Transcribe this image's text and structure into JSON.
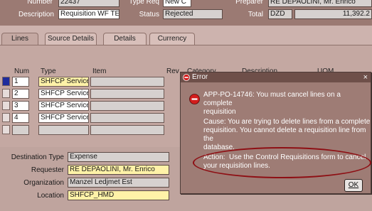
{
  "header": {
    "number_label": "Number",
    "number_value": "22437",
    "type_label": "Type Req",
    "type_value": "New C",
    "preparer_label": "Preparer",
    "preparer_value": "RE DEPAOLINI, Mr. Enrico",
    "description_label": "Description",
    "description_value": "Requisition WF TE",
    "status_label": "Status",
    "status_value": "Rejected",
    "total_label": "Total",
    "currency_value": "DZD",
    "total_value": "11,392.2"
  },
  "tabs": [
    {
      "label": "Lines"
    },
    {
      "label": "Source Details"
    },
    {
      "label": "Details"
    },
    {
      "label": "Currency"
    }
  ],
  "lines_table": {
    "columns": [
      "Num",
      "Type",
      "Item",
      "Rev",
      "Category",
      "Description",
      "UOM"
    ],
    "rows": [
      {
        "num": "1",
        "type": "SHFCP Service"
      },
      {
        "num": "2",
        "type": "SHFCP Service"
      },
      {
        "num": "3",
        "type": "SHFCP Service"
      },
      {
        "num": "4",
        "type": "SHFCP Service"
      }
    ]
  },
  "details": {
    "destination_type_label": "Destination Type",
    "destination_type_value": "Expense",
    "requester_label": "Requester",
    "requester_value": "RE DEPAOLINI, Mr. Enrico",
    "organization_label": "Organization",
    "organization_value": "Manzel Ledjmet Est",
    "location_label": "Location",
    "location_value": "SHFCP_HMD"
  },
  "dialog": {
    "title": "Error",
    "close_glyph": "×",
    "message_line1": "APP-PO-14746: You must cancel lines on a complete",
    "message_line2": "requisition",
    "cause_label": "Cause:",
    "cause_line1": "You are trying to delete lines from a complete",
    "cause_line2": "requisition. You cannot delete a requisition line from the",
    "cause_line3": "database.",
    "action_label": "Action:",
    "action_line1": "Use the Control Requisitions form to cancel",
    "action_line2": "your requisition lines.",
    "ok_label": "OK"
  },
  "icons": {
    "title_icon": "error-icon",
    "message_icon": "stop-icon"
  },
  "colors": {
    "header_band": "#9b7a73",
    "form_background": "#c4a8a2",
    "dialog_background": "#9e7c75",
    "required_field": "#fff2a8",
    "highlight_ellipse": "#8e0f14"
  }
}
